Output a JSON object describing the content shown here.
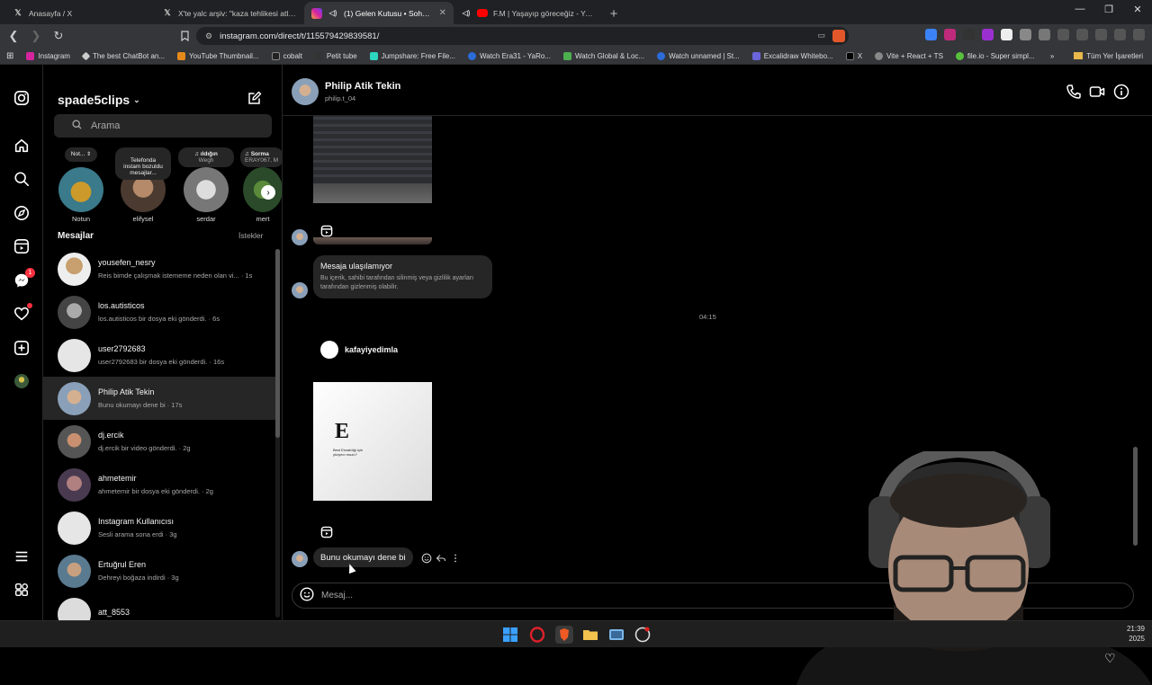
{
  "browser": {
    "tabs": [
      {
        "title": "Anasayfa / X",
        "icon": "x-logo-icon",
        "active": false
      },
      {
        "title": "X'te yalc arşiv: \"kaza tehlikesi atlatıno",
        "icon": "x-logo-icon",
        "active": false
      },
      {
        "title": "(1) Gelen Kutusu • Sohbetler",
        "icon": "instagram-icon",
        "active": true
      },
      {
        "title": "F.M | Yaşayıp göreceğiz - YouTube",
        "icon": "youtube-icon",
        "active": false
      }
    ],
    "url": "instagram.com/direct/t/115579429839581/",
    "bookmarks": [
      "Instagram",
      "The best ChatBot an...",
      "YouTube Thumbnail...",
      "cobalt",
      "Petit tube",
      "Jumpshare: Free File...",
      "Watch Era31 - YaRo...",
      "Watch Global & Loc...",
      "Watch unnamed | St...",
      "Excalidraw Whitebo...",
      "X",
      "Vite + React + TS",
      "file.io - Super simpl..."
    ],
    "all_bookmarks": "Tüm Yer İşaretleri"
  },
  "inbox": {
    "username": "spade5clips",
    "search_placeholder": "Arama",
    "notes": [
      {
        "name": "Notun",
        "bubble": "Not..."
      },
      {
        "name": "elifysel",
        "bubble": "Telefonda\ninstam bozuldu\nmesajlar..."
      },
      {
        "name": "serdar",
        "bubble": "ıldığın",
        "bubble_sub": "Wegh"
      },
      {
        "name": "mert",
        "bubble": "Sorma",
        "bubble_sub": "ERAY067, M"
      }
    ],
    "section_title": "Mesajlar",
    "requests_label": "İstekler",
    "conversations": [
      {
        "name": "yousefen_nesry",
        "preview": "Reis bimde çalışmak istememe neden olan vi... · 1s",
        "avatar": "#8a6a3a"
      },
      {
        "name": "los.autisticos",
        "preview": "los.autisticos bir dosya eki gönderdi. · 6s",
        "avatar": "#6e6e6e"
      },
      {
        "name": "user2792683",
        "preview": "user2792683 bir dosya eki gönderdi. · 16s",
        "avatar": "#e6e6e6"
      },
      {
        "name": "Philip Atik Tekin",
        "preview": "Bunu okumayı dene bi · 17s",
        "avatar": "#8aa0b8",
        "active": true
      },
      {
        "name": "dj.ercik",
        "preview": "dj.ercik bir video gönderdi. · 2g",
        "avatar": "#9a7a5a"
      },
      {
        "name": "ahmetemir",
        "preview": "ahmetemir bir dosya eki gönderdi. · 2g",
        "avatar": "#7a5a70"
      },
      {
        "name": "Instagram Kullanıcısı",
        "preview": "Sesli arama sona erdi · 3g",
        "avatar": "#e6e6e6"
      },
      {
        "name": "Ertuğrul Eren",
        "preview": "Dehreyi boğaza indirdi · 3g",
        "avatar": "#5a7a90"
      },
      {
        "name": "att_8553",
        "preview": "",
        "avatar": "#dcdcdc"
      }
    ]
  },
  "chat": {
    "contact_name": "Philip Atik Tekin",
    "contact_username": "philip.t_04",
    "unavailable_title": "Mesaja ulaşılamıyor",
    "unavailable_body": "Bu içerik, sahibi tarafından silinmiş veya gizlilik ayarları tarafından gizlenmiş olabilir.",
    "timestamp": "04:15",
    "post_author": "kafayiyedimla",
    "post_letter": "E",
    "post_caption": "Best Esnafdığı için yüzyecı muzu?",
    "last_message": "Bunu okumayı dene bi",
    "composer_placeholder": "Mesaj..."
  },
  "taskbar": {
    "time": "21:39",
    "date": "2025"
  }
}
